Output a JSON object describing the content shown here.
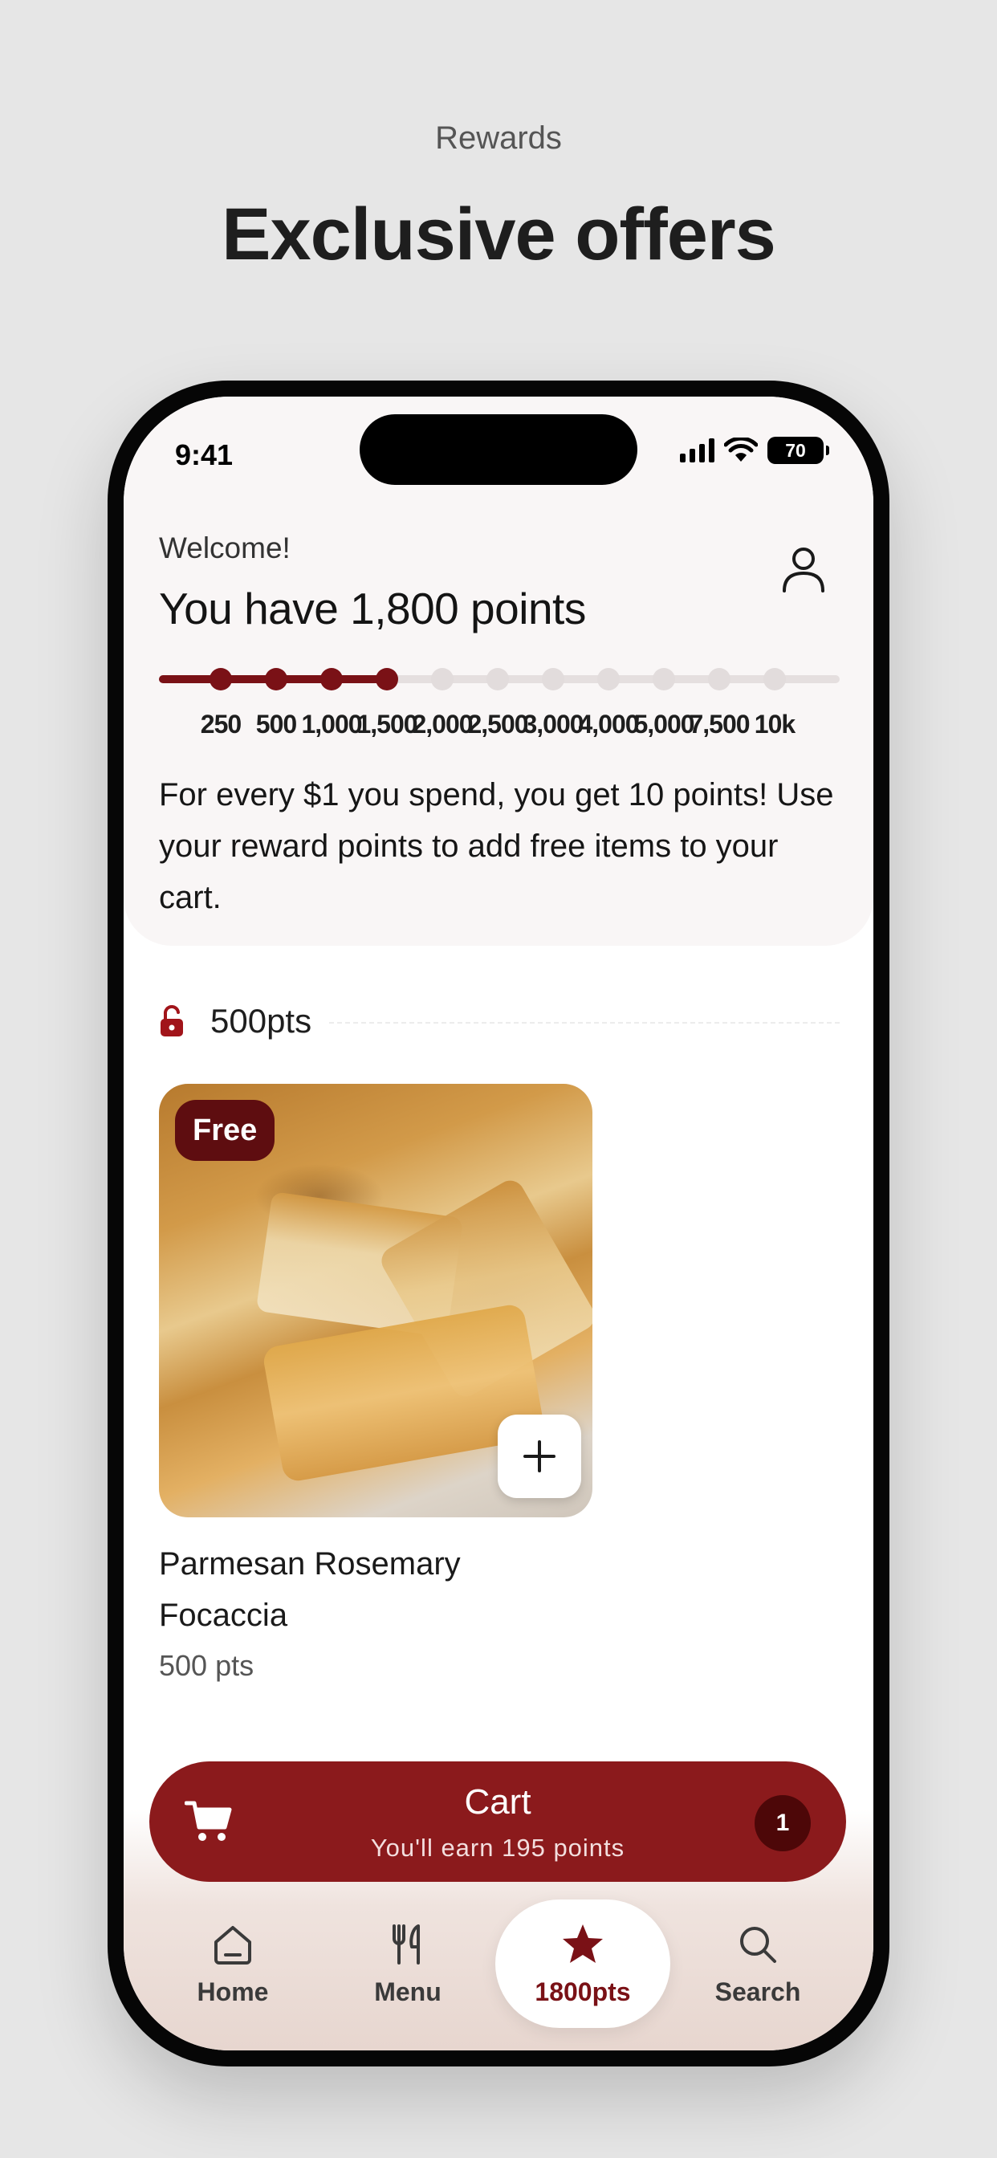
{
  "promo": {
    "eyebrow": "Rewards",
    "title": "Exclusive offers"
  },
  "status_bar": {
    "time": "9:41",
    "battery": "70"
  },
  "header": {
    "welcome": "Welcome!",
    "points_title": "You have 1,800 points"
  },
  "progress": {
    "current_points": 1800,
    "milestones": [
      "250",
      "500",
      "1,000",
      "1,500",
      "2,000",
      "2,500",
      "3,000",
      "4,000",
      "5,000",
      "7,500",
      "10k"
    ],
    "reached_count": 4
  },
  "info": {
    "text": "For every $1 you spend, you get 10 points! Use your reward points to add free items to your cart."
  },
  "tier": {
    "label": "500pts"
  },
  "product": {
    "badge": "Free",
    "name": "Parmesan Rosemary Focaccia",
    "points": "500 pts"
  },
  "cart": {
    "title": "Cart",
    "subtitle": "You'll earn 195 points",
    "count": "1"
  },
  "tabs": [
    {
      "label": "Home",
      "icon": "home-icon"
    },
    {
      "label": "Menu",
      "icon": "utensils-icon"
    },
    {
      "label": "1800pts",
      "icon": "star-icon"
    },
    {
      "label": "Search",
      "icon": "search-icon"
    }
  ],
  "colors": {
    "brand": "#8b1a1c",
    "brand_dark": "#5e0d10",
    "progress_inactive": "#e5dfdf"
  }
}
